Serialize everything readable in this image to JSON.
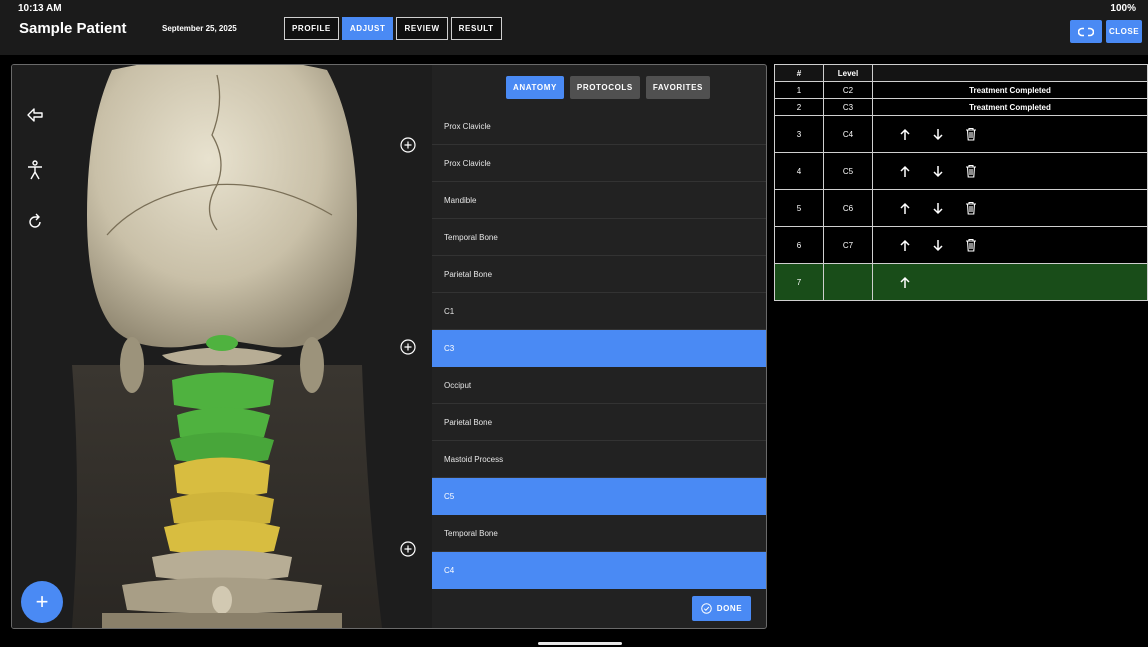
{
  "status": {
    "time": "10:13 AM",
    "battery": "100%"
  },
  "header": {
    "patient_name": "Sample Patient",
    "date": "September 25, 2025",
    "tabs": [
      "PROFILE",
      "ADJUST",
      "REVIEW",
      "RESULT"
    ],
    "active_tab": "ADJUST",
    "close_label": "CLOSE",
    "link_icon": "link-icon"
  },
  "toolbar": {
    "icons": [
      "undo-icon",
      "body-figure-icon",
      "reset-rotate-icon"
    ]
  },
  "filter_tabs": [
    "ANATOMY",
    "PROTOCOLS",
    "FAVORITES"
  ],
  "anatomy_list": [
    {
      "label": "Prox Clavicle",
      "selected": false
    },
    {
      "label": "Prox Clavicle",
      "selected": false
    },
    {
      "label": "Mandible",
      "selected": false
    },
    {
      "label": "Temporal Bone",
      "selected": false
    },
    {
      "label": "Parietal Bone",
      "selected": false
    },
    {
      "label": "C1",
      "selected": false
    },
    {
      "label": "C3",
      "selected": true
    },
    {
      "label": "Occiput",
      "selected": false
    },
    {
      "label": "Parietal Bone",
      "selected": false
    },
    {
      "label": "Mastoid Process",
      "selected": false
    },
    {
      "label": "C5",
      "selected": true
    },
    {
      "label": "Temporal Bone",
      "selected": false
    },
    {
      "label": "C4",
      "selected": true
    }
  ],
  "done_label": "DONE",
  "fab_label": "+",
  "table": {
    "headers": [
      "#",
      "Level",
      ""
    ],
    "rows": [
      {
        "num": "1",
        "level": "C2",
        "status": "Treatment Completed"
      },
      {
        "num": "2",
        "level": "C3",
        "status": "Treatment Completed"
      },
      {
        "num": "3",
        "level": "C4",
        "actions": [
          "up",
          "down",
          "delete"
        ]
      },
      {
        "num": "4",
        "level": "C5",
        "actions": [
          "up",
          "down",
          "delete"
        ]
      },
      {
        "num": "5",
        "level": "C6",
        "actions": [
          "up",
          "down",
          "delete"
        ]
      },
      {
        "num": "6",
        "level": "C7",
        "actions": [
          "up",
          "down",
          "delete"
        ]
      },
      {
        "num": "7",
        "level": "",
        "actions": [
          "up"
        ],
        "added": true
      }
    ]
  },
  "colors": {
    "accent": "#4a8af4",
    "added_row": "#194d19",
    "highlight_green": "#4fb23f",
    "highlight_yellow": "#d8bd40"
  }
}
